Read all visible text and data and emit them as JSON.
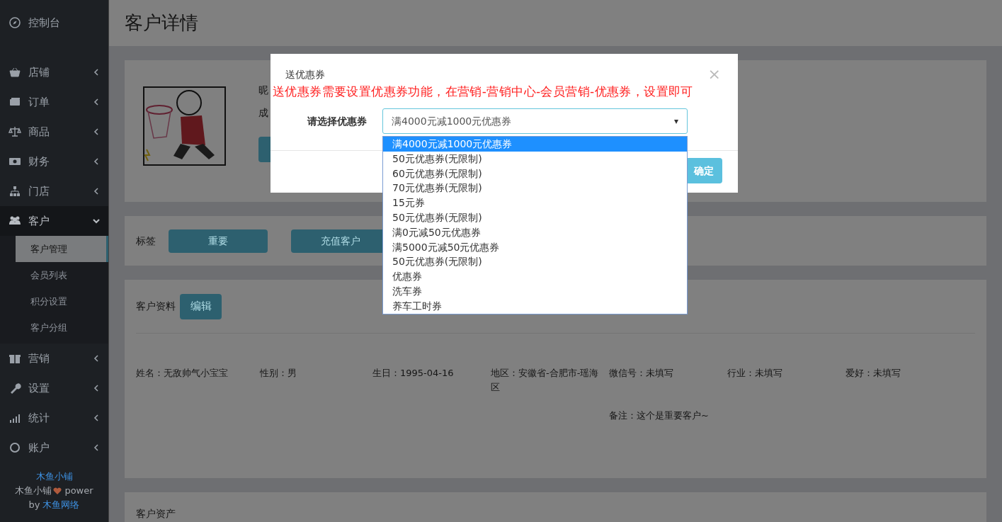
{
  "sidebar": {
    "items": [
      {
        "label": "控制台"
      },
      {
        "label": "店铺",
        "expanded": false
      },
      {
        "label": "订单",
        "expanded": false
      },
      {
        "label": "商品",
        "expanded": false
      },
      {
        "label": "财务",
        "expanded": false
      },
      {
        "label": "门店",
        "expanded": false
      },
      {
        "label": "客户",
        "expanded": true,
        "children": [
          {
            "label": "客户管理",
            "selected": true
          },
          {
            "label": "会员列表",
            "selected": false
          },
          {
            "label": "积分设置",
            "selected": false
          },
          {
            "label": "客户分组",
            "selected": false
          }
        ]
      },
      {
        "label": "营销",
        "expanded": false
      },
      {
        "label": "设置",
        "expanded": false
      },
      {
        "label": "统计",
        "expanded": false
      },
      {
        "label": "账户",
        "expanded": false
      }
    ],
    "footer": {
      "brand": "木鱼小铺",
      "power_lines": [
        "木鱼小铺",
        "power"
      ],
      "by": "by",
      "company": "木鱼网络"
    }
  },
  "page_title": "客户详情",
  "profile": {
    "texts": [
      "昵",
      "成"
    ]
  },
  "tags": {
    "label": "标签",
    "items": [
      "重要",
      "充值客户"
    ]
  },
  "customer_info": {
    "title": "客户资料",
    "edit_button": "编辑",
    "fields": [
      "姓名：无敌帅气小宝宝",
      "性别：男",
      "生日：1995-04-16",
      "地区：安徽省-合肥市-瑶海区",
      "微信号：未填写",
      "行业：未填写",
      "爱好：未填写"
    ],
    "note": "备注：这个是重要客户~"
  },
  "assets": {
    "title": "客户资产"
  },
  "modal": {
    "title": "送优惠券",
    "close": "×",
    "notice": "送优惠券需要设置优惠券功能，在营销-营销中心-会员营销-优惠券，设置即可",
    "label": "请选择优惠券",
    "value": "满4000元减1000元优惠券",
    "caret": "▾",
    "confirm": "确定",
    "options": [
      {
        "label": "满4000元减1000元优惠券",
        "selected": true
      },
      {
        "label": "50元优惠券(无限制)",
        "selected": false
      },
      {
        "label": "60元优惠券(无限制)",
        "selected": false
      },
      {
        "label": "70元优惠券(无限制)",
        "selected": false
      },
      {
        "label": "15元券",
        "selected": false
      },
      {
        "label": "50元优惠券(无限制)",
        "selected": false
      },
      {
        "label": "满0元减50元优惠券",
        "selected": false
      },
      {
        "label": "满5000元减50元优惠券",
        "selected": false
      },
      {
        "label": "50元优惠券(无限制)",
        "selected": false
      },
      {
        "label": "优惠券",
        "selected": false
      },
      {
        "label": "洗车券",
        "selected": false
      },
      {
        "label": "养车工时券",
        "selected": false
      }
    ]
  }
}
